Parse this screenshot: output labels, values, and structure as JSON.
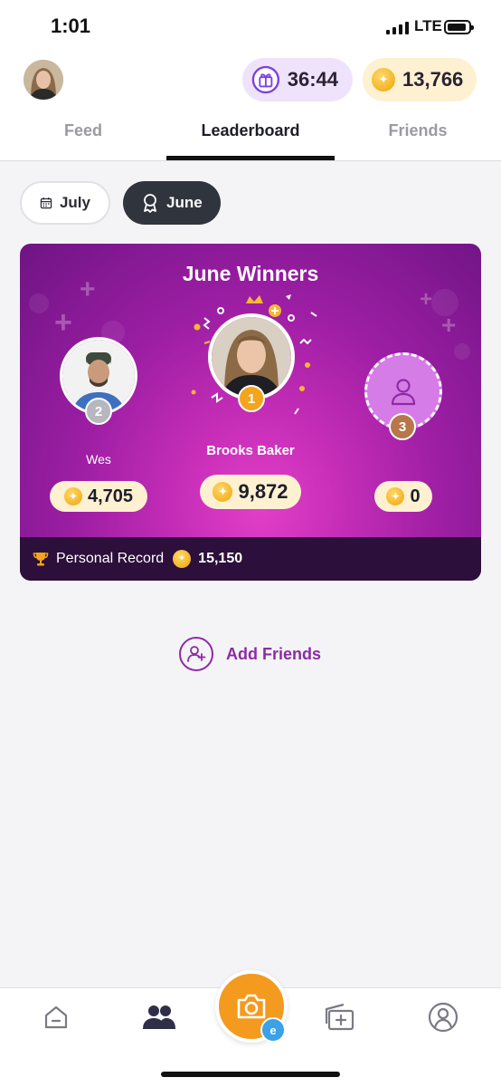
{
  "status_bar": {
    "time": "1:01",
    "network": "LTE"
  },
  "header": {
    "timer": "36:44",
    "coins": "13,766"
  },
  "tabs": [
    {
      "label": "Feed",
      "active": false
    },
    {
      "label": "Leaderboard",
      "active": true
    },
    {
      "label": "Friends",
      "active": false
    }
  ],
  "month_filter": {
    "july_label": "July",
    "june_label": "June",
    "selected": "June"
  },
  "winners_card": {
    "title": "June Winners",
    "first": {
      "rank": "1",
      "name": "Brooks Baker",
      "score": "9,872"
    },
    "second": {
      "rank": "2",
      "name": "Wes",
      "score": "4,705"
    },
    "third": {
      "rank": "3",
      "name": "",
      "score": "0"
    },
    "personal_record_label": "Personal Record",
    "personal_record_value": "15,150"
  },
  "add_friends": {
    "label": "Add Friends"
  },
  "bottom_nav": {
    "items": [
      "home-icon",
      "friends-icon",
      "camera-icon",
      "rewards-icon",
      "profile-icon"
    ],
    "active": "friends-icon",
    "receipt_badge": "e"
  },
  "colors": {
    "accent_purple": "#8e2aa5",
    "card_gradient_center": "#e33fc8",
    "card_gradient_edge": "#6e1484",
    "coin_gold": "#f3b425",
    "camera_orange": "#f39a1f"
  }
}
